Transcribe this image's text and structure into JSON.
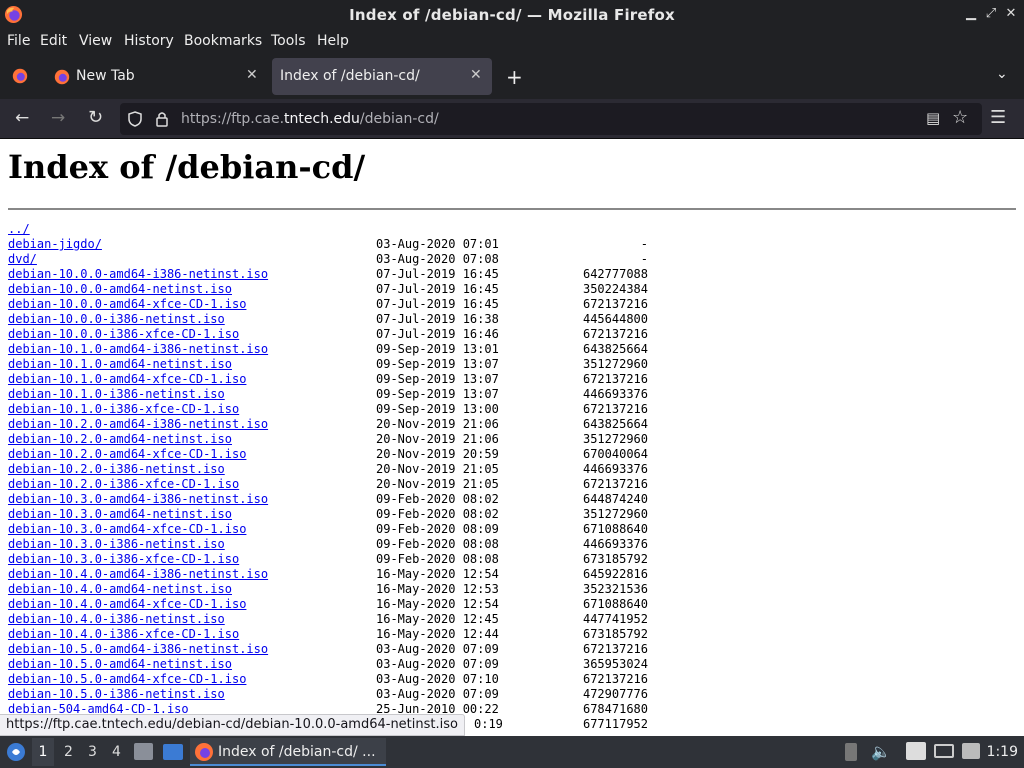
{
  "window": {
    "title": "Index of /debian-cd/ — Mozilla Firefox"
  },
  "menu": [
    "File",
    "Edit",
    "View",
    "History",
    "Bookmarks",
    "Tools",
    "Help"
  ],
  "tabs": [
    {
      "label": "New Tab"
    },
    {
      "label": "Index of /debian-cd/"
    }
  ],
  "url": {
    "prefix": "https://ftp.cae.",
    "domain": "tntech.edu",
    "suffix": "/debian-cd/"
  },
  "page": {
    "heading": "Index of /debian-cd/",
    "entries": [
      {
        "name": "../",
        "date": "",
        "size": ""
      },
      {
        "name": "debian-jigdo/",
        "date": "03-Aug-2020 07:01",
        "size": "-"
      },
      {
        "name": "dvd/",
        "date": "03-Aug-2020 07:08",
        "size": "-"
      },
      {
        "name": "debian-10.0.0-amd64-i386-netinst.iso",
        "date": "07-Jul-2019 16:45",
        "size": "642777088"
      },
      {
        "name": "debian-10.0.0-amd64-netinst.iso",
        "date": "07-Jul-2019 16:45",
        "size": "350224384"
      },
      {
        "name": "debian-10.0.0-amd64-xfce-CD-1.iso",
        "date": "07-Jul-2019 16:45",
        "size": "672137216"
      },
      {
        "name": "debian-10.0.0-i386-netinst.iso",
        "date": "07-Jul-2019 16:38",
        "size": "445644800"
      },
      {
        "name": "debian-10.0.0-i386-xfce-CD-1.iso",
        "date": "07-Jul-2019 16:46",
        "size": "672137216"
      },
      {
        "name": "debian-10.1.0-amd64-i386-netinst.iso",
        "date": "09-Sep-2019 13:01",
        "size": "643825664"
      },
      {
        "name": "debian-10.1.0-amd64-netinst.iso",
        "date": "09-Sep-2019 13:07",
        "size": "351272960"
      },
      {
        "name": "debian-10.1.0-amd64-xfce-CD-1.iso",
        "date": "09-Sep-2019 13:07",
        "size": "672137216"
      },
      {
        "name": "debian-10.1.0-i386-netinst.iso",
        "date": "09-Sep-2019 13:07",
        "size": "446693376"
      },
      {
        "name": "debian-10.1.0-i386-xfce-CD-1.iso",
        "date": "09-Sep-2019 13:00",
        "size": "672137216"
      },
      {
        "name": "debian-10.2.0-amd64-i386-netinst.iso",
        "date": "20-Nov-2019 21:06",
        "size": "643825664"
      },
      {
        "name": "debian-10.2.0-amd64-netinst.iso",
        "date": "20-Nov-2019 21:06",
        "size": "351272960"
      },
      {
        "name": "debian-10.2.0-amd64-xfce-CD-1.iso",
        "date": "20-Nov-2019 20:59",
        "size": "670040064"
      },
      {
        "name": "debian-10.2.0-i386-netinst.iso",
        "date": "20-Nov-2019 21:05",
        "size": "446693376"
      },
      {
        "name": "debian-10.2.0-i386-xfce-CD-1.iso",
        "date": "20-Nov-2019 21:05",
        "size": "672137216"
      },
      {
        "name": "debian-10.3.0-amd64-i386-netinst.iso",
        "date": "09-Feb-2020 08:02",
        "size": "644874240"
      },
      {
        "name": "debian-10.3.0-amd64-netinst.iso",
        "date": "09-Feb-2020 08:02",
        "size": "351272960"
      },
      {
        "name": "debian-10.3.0-amd64-xfce-CD-1.iso",
        "date": "09-Feb-2020 08:09",
        "size": "671088640"
      },
      {
        "name": "debian-10.3.0-i386-netinst.iso",
        "date": "09-Feb-2020 08:08",
        "size": "446693376"
      },
      {
        "name": "debian-10.3.0-i386-xfce-CD-1.iso",
        "date": "09-Feb-2020 08:08",
        "size": "673185792"
      },
      {
        "name": "debian-10.4.0-amd64-i386-netinst.iso",
        "date": "16-May-2020 12:54",
        "size": "645922816"
      },
      {
        "name": "debian-10.4.0-amd64-netinst.iso",
        "date": "16-May-2020 12:53",
        "size": "352321536"
      },
      {
        "name": "debian-10.4.0-amd64-xfce-CD-1.iso",
        "date": "16-May-2020 12:54",
        "size": "671088640"
      },
      {
        "name": "debian-10.4.0-i386-netinst.iso",
        "date": "16-May-2020 12:45",
        "size": "447741952"
      },
      {
        "name": "debian-10.4.0-i386-xfce-CD-1.iso",
        "date": "16-May-2020 12:44",
        "size": "673185792"
      },
      {
        "name": "debian-10.5.0-amd64-i386-netinst.iso",
        "date": "03-Aug-2020 07:09",
        "size": "672137216"
      },
      {
        "name": "debian-10.5.0-amd64-netinst.iso",
        "date": "03-Aug-2020 07:09",
        "size": "365953024"
      },
      {
        "name": "debian-10.5.0-amd64-xfce-CD-1.iso",
        "date": "03-Aug-2020 07:10",
        "size": "672137216"
      },
      {
        "name": "debian-10.5.0-i386-netinst.iso",
        "date": "03-Aug-2020 07:09",
        "size": "472907776"
      },
      {
        "name": "debian-504-amd64-CD-1.iso",
        "date": "25-Jun-2010 00:22",
        "size": "678471680"
      },
      {
        "name": "",
        "date": "0:19",
        "size": "677117952"
      }
    ]
  },
  "statusbar": {
    "text": "https://ftp.cae.tntech.edu/debian-cd/debian-10.0.0-amd64-netinst.iso"
  },
  "taskbar": {
    "workspaces": [
      "1",
      "2",
      "3",
      "4"
    ],
    "app_label": "Index of /debian-cd/ ...",
    "clock": "1:19"
  }
}
